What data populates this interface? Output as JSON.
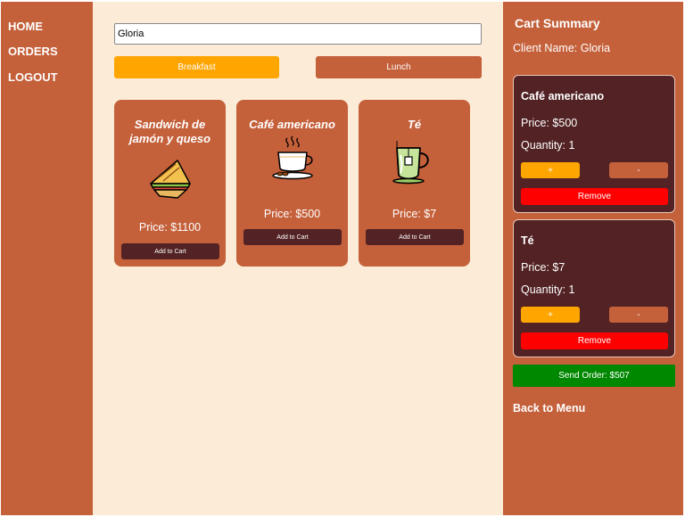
{
  "nav": {
    "home": "HOME",
    "orders": "ORDERS",
    "logout": "LOGOUT"
  },
  "search": {
    "value": "Gloria"
  },
  "tabs": {
    "breakfast": "Breakfast",
    "lunch": "Lunch"
  },
  "products": [
    {
      "name": "Sandwich de jamón y queso",
      "price": "Price: $1100",
      "button": "Add to Cart",
      "icon": "sandwich-icon"
    },
    {
      "name": "Café americano",
      "price": "Price: $500",
      "button": "Add to Cart",
      "icon": "coffee-cup-icon"
    },
    {
      "name": "Té",
      "price": "Price: $7",
      "button": "Add to Cart",
      "icon": "tea-cup-icon"
    }
  ],
  "cart": {
    "title": "Cart Summary",
    "client": "Client Name: Gloria",
    "items": [
      {
        "name": "Café americano",
        "price": "Price: $500",
        "quantity": "Quantity: 1",
        "plus": "+",
        "minus": "-",
        "remove": "Remove"
      },
      {
        "name": "Té",
        "price": "Price: $7",
        "quantity": "Quantity: 1",
        "plus": "+",
        "minus": "-",
        "remove": "Remove"
      }
    ],
    "send": "Send Order: $507",
    "back": "Back to Menu"
  },
  "colors": {
    "primary": "#c4603a",
    "dark": "#522224",
    "accent": "#fea500",
    "danger": "#ff0000",
    "success": "#008800",
    "background": "#fcebd7"
  }
}
